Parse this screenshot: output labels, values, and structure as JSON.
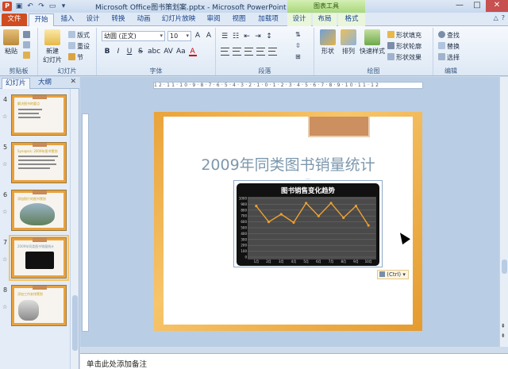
{
  "window": {
    "title": "Microsoft Office图书策划案.pptx - Microsoft PowerPoint",
    "context_tab_group": "图表工具",
    "controls": {
      "minimize": "—",
      "maximize": "□",
      "close": "✕"
    }
  },
  "qat": [
    "save-icon",
    "undo-icon",
    "redo-icon",
    "folder-icon",
    "dropdown-icon"
  ],
  "tabs": [
    {
      "label": "文件",
      "name": "file"
    },
    {
      "label": "开始",
      "name": "home",
      "active": true
    },
    {
      "label": "插入",
      "name": "insert"
    },
    {
      "label": "设计",
      "name": "design"
    },
    {
      "label": "转换",
      "name": "transitions"
    },
    {
      "label": "动画",
      "name": "animations"
    },
    {
      "label": "幻灯片放映",
      "name": "slideshow"
    },
    {
      "label": "审阅",
      "name": "review"
    },
    {
      "label": "视图",
      "name": "view"
    },
    {
      "label": "加载项",
      "name": "addins"
    },
    {
      "label": "设计",
      "name": "chart-design",
      "context": true
    },
    {
      "label": "布局",
      "name": "chart-layout",
      "context": true
    },
    {
      "label": "格式",
      "name": "chart-format",
      "context": true
    }
  ],
  "ribbon": {
    "clipboard": {
      "label": "剪贴板",
      "paste": "粘贴"
    },
    "slides": {
      "label": "幻灯片",
      "new_slide_1": "新建",
      "new_slide_2": "幻灯片",
      "layout": "版式",
      "reset": "重设",
      "section": "节"
    },
    "font": {
      "label": "字体",
      "font_name": "幼圆 (正文)",
      "font_size": "10"
    },
    "paragraph": {
      "label": "段落"
    },
    "drawing": {
      "label": "绘图",
      "shapes": "形状",
      "arrange": "排列",
      "quick_styles": "快速样式",
      "shape_fill": "形状填充",
      "shape_outline": "形状轮廓",
      "shape_effects": "形状效果"
    },
    "editing": {
      "label": "编辑",
      "find": "查找",
      "replace": "替换",
      "select": "选择"
    }
  },
  "left_panel": {
    "tabs": [
      "幻灯片",
      "大纲"
    ],
    "thumbnails": [
      {
        "number": "4",
        "star": "☆",
        "title": "解决图书的要点"
      },
      {
        "number": "5",
        "star": "☆",
        "title": "Synopsis: 2009年图书策划"
      },
      {
        "number": "6",
        "star": "☆",
        "title": "添加照片的图书策划"
      },
      {
        "number": "7",
        "star": "☆",
        "title": "2009年同类图书销量统计",
        "selected": true
      },
      {
        "number": "8",
        "star": "☆",
        "title": "添加工作安排策划"
      }
    ]
  },
  "slide": {
    "title": "2009年同类图书销量统计",
    "paste_options": "(Ctrl)"
  },
  "chart_data": {
    "type": "line",
    "title": "图书销售变化趋势",
    "categories": [
      "1月",
      "2月",
      "3月",
      "4月",
      "5月",
      "6月",
      "7月",
      "8月",
      "9月",
      "10月"
    ],
    "y_ticks": [
      "0",
      "100",
      "200",
      "300",
      "400",
      "500",
      "600",
      "700",
      "800",
      "900",
      "1000"
    ],
    "values": [
      870,
      600,
      730,
      590,
      920,
      700,
      920,
      670,
      870,
      540
    ],
    "ylim": [
      0,
      1000
    ],
    "grid": true,
    "line_color": "#f0a030"
  },
  "notes": {
    "placeholder": "单击此处添加备注"
  }
}
